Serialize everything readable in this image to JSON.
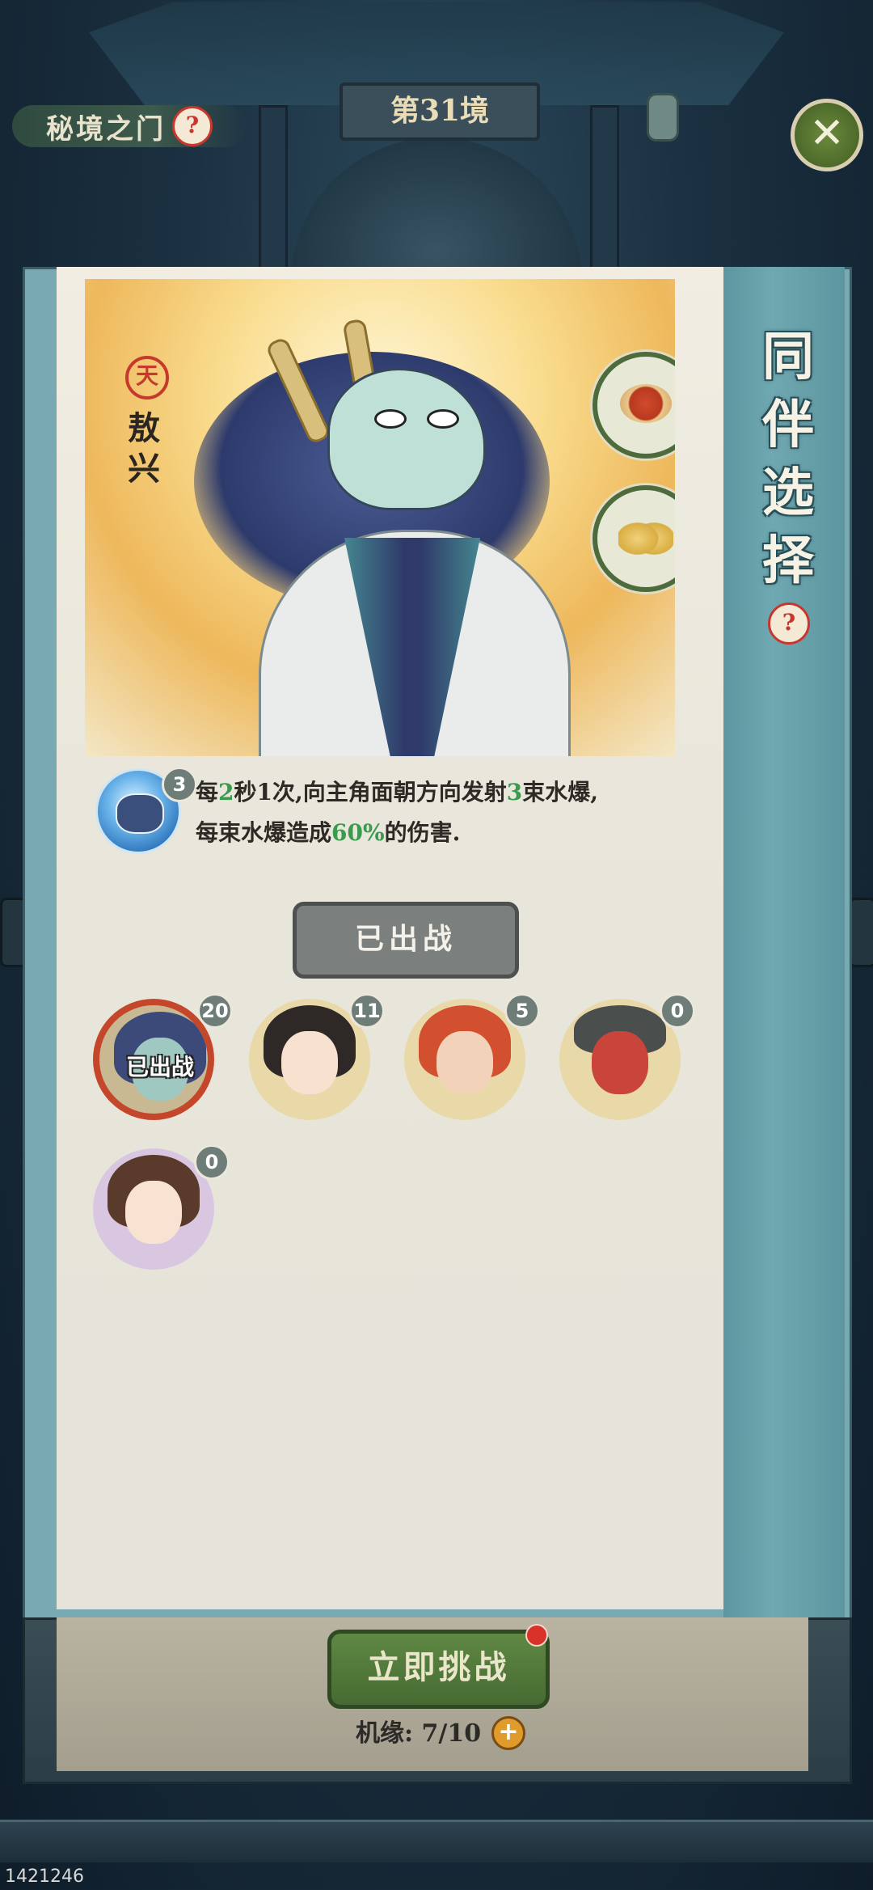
{
  "header": {
    "location": "秘境之门",
    "realm": "第31境",
    "help_glyph": "?",
    "close_glyph": "✕"
  },
  "panel": {
    "side_title": [
      "同",
      "伴",
      "选",
      "择"
    ],
    "side_help_glyph": "?"
  },
  "character": {
    "grade_seal": "天",
    "name": [
      "敖",
      "兴"
    ],
    "items": [
      "dish-icon",
      "moth-icon"
    ]
  },
  "skill": {
    "level": "3",
    "text": {
      "p1": "每",
      "n1": "2",
      "p2": "秒1次,向主角面朝方向发射",
      "n2": "3",
      "p3": "束水爆,",
      "p4": "每束水爆造成",
      "n3": "60%",
      "p5": "的伤害."
    }
  },
  "status_button": "已出战",
  "companions": [
    {
      "name": "敖兴",
      "level": "20",
      "deployed": true,
      "deployed_label": "已出战"
    },
    {
      "name": "companion-2",
      "level": "11",
      "deployed": false
    },
    {
      "name": "companion-3",
      "level": "5",
      "deployed": false
    },
    {
      "name": "companion-4",
      "level": "0",
      "deployed": false
    },
    {
      "name": "companion-5",
      "level": "0",
      "deployed": false
    }
  ],
  "footer": {
    "challenge_button": "立即挑战",
    "chance_label": "机缘: 7/10",
    "plus_glyph": "+"
  },
  "user_id": "1421246",
  "colors": {
    "accent_green": "#3a9a4e",
    "deployed_red": "#c4472c",
    "panel_teal": "#70a8b1"
  }
}
